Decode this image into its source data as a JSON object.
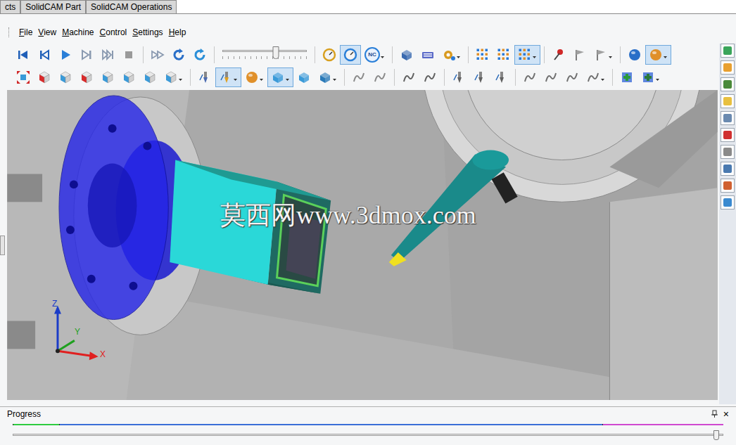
{
  "document_tabs": [
    {
      "label": "cts",
      "selected": false
    },
    {
      "label": "SolidCAM Part",
      "selected": false
    },
    {
      "label": "SolidCAM Operations",
      "selected": false
    }
  ],
  "menu": [
    "File",
    "View",
    "Machine",
    "Control",
    "Settings",
    "Help"
  ],
  "toolbar_top": [
    {
      "kind": "skip-start",
      "selected": false,
      "dropdown": false,
      "color": "#1f5fb8"
    },
    {
      "kind": "step-back",
      "selected": false,
      "dropdown": false,
      "color": "#1f5fb8"
    },
    {
      "kind": "play",
      "selected": false,
      "dropdown": false,
      "color": "#2a7fd8"
    },
    {
      "kind": "step-fwd",
      "selected": false,
      "dropdown": false,
      "color": "#8a9ab0"
    },
    {
      "kind": "skip-end",
      "selected": false,
      "dropdown": false,
      "color": "#8a9ab0"
    },
    {
      "kind": "stop",
      "selected": false,
      "dropdown": false,
      "color": "#9a9a9a"
    },
    {
      "kind": "sep"
    },
    {
      "kind": "fast-forward",
      "selected": false,
      "dropdown": false,
      "color": "#8a9ab0"
    },
    {
      "kind": "rotate",
      "selected": false,
      "dropdown": false,
      "color": "#2a6fc8"
    },
    {
      "kind": "rotate",
      "selected": false,
      "dropdown": false,
      "color": "#2a8fd8"
    },
    {
      "kind": "sep"
    },
    {
      "kind": "slider",
      "level": 0.63
    },
    {
      "kind": "sep"
    },
    {
      "kind": "dial",
      "selected": false,
      "dropdown": false,
      "color": "#d8a020"
    },
    {
      "kind": "dial",
      "selected": true,
      "dropdown": false,
      "color": "#2a7fd8"
    },
    {
      "kind": "badge",
      "label": "NC",
      "selected": false,
      "dropdown": true,
      "color": "#2a7fd8"
    },
    {
      "kind": "sep"
    },
    {
      "kind": "box",
      "selected": false,
      "dropdown": false,
      "color": "#3a6ab0"
    },
    {
      "kind": "keyboard",
      "selected": false,
      "dropdown": false,
      "color": "#5a6ac8"
    },
    {
      "kind": "gear",
      "selected": false,
      "dropdown": true,
      "color": "#d89a20"
    },
    {
      "kind": "sep"
    },
    {
      "kind": "grid",
      "selected": false,
      "dropdown": false,
      "color": "#e0902a"
    },
    {
      "kind": "grid",
      "selected": false,
      "dropdown": false,
      "color": "#e0902a"
    },
    {
      "kind": "grid",
      "selected": true,
      "dropdown": true,
      "color": "#e0902a"
    },
    {
      "kind": "sep"
    },
    {
      "kind": "pin",
      "selected": false,
      "dropdown": false,
      "color": "#d02828"
    },
    {
      "kind": "flag",
      "selected": false,
      "dropdown": false,
      "color": "#a0a0a0"
    },
    {
      "kind": "flag",
      "selected": false,
      "dropdown": true,
      "color": "#a0a0a0"
    },
    {
      "kind": "sep"
    },
    {
      "kind": "sphere",
      "selected": false,
      "dropdown": false,
      "color": "#2a6fc8"
    },
    {
      "kind": "sphere",
      "selected": true,
      "dropdown": true,
      "color": "#e0902a"
    }
  ],
  "toolbar_bottom": [
    {
      "kind": "fit",
      "selected": false,
      "dropdown": false,
      "color": "#d02828"
    },
    {
      "kind": "cube",
      "selected": false,
      "dropdown": false,
      "color": "#d82a2a"
    },
    {
      "kind": "cube",
      "selected": false,
      "dropdown": false,
      "color": "#3a9ad8"
    },
    {
      "kind": "cube",
      "selected": false,
      "dropdown": false,
      "color": "#d82a2a"
    },
    {
      "kind": "cube",
      "selected": false,
      "dropdown": false,
      "color": "#3a9ad8"
    },
    {
      "kind": "cube",
      "selected": false,
      "dropdown": false,
      "color": "#3a9ad8"
    },
    {
      "kind": "cube",
      "selected": false,
      "dropdown": false,
      "color": "#3a9ad8"
    },
    {
      "kind": "cube",
      "selected": false,
      "dropdown": true,
      "color": "#3a9ad8"
    },
    {
      "kind": "sep"
    },
    {
      "kind": "tool",
      "selected": false,
      "dropdown": false,
      "color": "#4a6ab0"
    },
    {
      "kind": "tool",
      "selected": true,
      "dropdown": true,
      "color": "#e0a020"
    },
    {
      "kind": "sphere",
      "selected": false,
      "dropdown": true,
      "color": "#e0902a"
    },
    {
      "kind": "box",
      "selected": true,
      "dropdown": true,
      "color": "#3a9ad8"
    },
    {
      "kind": "box",
      "selected": false,
      "dropdown": false,
      "color": "#3a9ad8"
    },
    {
      "kind": "box",
      "selected": false,
      "dropdown": true,
      "color": "#2a7ab8"
    },
    {
      "kind": "sep"
    },
    {
      "kind": "curve",
      "selected": false,
      "dropdown": false,
      "color": "#8a8a8a"
    },
    {
      "kind": "curve",
      "selected": false,
      "dropdown": false,
      "color": "#8a8a8a"
    },
    {
      "kind": "sep"
    },
    {
      "kind": "curve",
      "selected": false,
      "dropdown": false,
      "color": "#606060"
    },
    {
      "kind": "curve",
      "selected": false,
      "dropdown": false,
      "color": "#606060"
    },
    {
      "kind": "sep"
    },
    {
      "kind": "tool",
      "selected": false,
      "dropdown": false,
      "color": "#606060"
    },
    {
      "kind": "tool",
      "selected": false,
      "dropdown": false,
      "color": "#606060"
    },
    {
      "kind": "tool",
      "selected": false,
      "dropdown": false,
      "color": "#606060"
    },
    {
      "kind": "sep"
    },
    {
      "kind": "curve",
      "selected": false,
      "dropdown": false,
      "color": "#707070"
    },
    {
      "kind": "curve",
      "selected": false,
      "dropdown": false,
      "color": "#707070"
    },
    {
      "kind": "curve",
      "selected": false,
      "dropdown": false,
      "color": "#707070"
    },
    {
      "kind": "curve",
      "selected": false,
      "dropdown": true,
      "color": "#707070"
    },
    {
      "kind": "sep"
    },
    {
      "kind": "add",
      "selected": false,
      "dropdown": false,
      "color": "#2a9a3a"
    },
    {
      "kind": "add",
      "selected": false,
      "dropdown": true,
      "color": "#2a7a3a"
    }
  ],
  "side_panel": [
    {
      "color": "#3aa55a"
    },
    {
      "color": "#e8a030"
    },
    {
      "color": "#4a8a3a"
    },
    {
      "color": "#e8c040"
    },
    {
      "color": "#6a8ab0"
    },
    {
      "color": "#d03030"
    },
    {
      "color": "#8a8a8a"
    },
    {
      "color": "#4a7ab0"
    },
    {
      "color": "#d06030"
    },
    {
      "color": "#3a8ad0"
    }
  ],
  "viewport": {
    "watermark": "莫西网www.3dmox.com",
    "axes": [
      {
        "label": "Z",
        "color": "#1a3cc8"
      },
      {
        "label": "Y",
        "color": "#1fa01f"
      },
      {
        "label": "X",
        "color": "#e02020"
      }
    ]
  },
  "progress_panel": {
    "title": "Progress",
    "close": "×",
    "level": 0.99,
    "segments": [
      {
        "color": "#2ecc40",
        "level": 0.065
      },
      {
        "color": "#3a6fd8",
        "level": 0.765
      },
      {
        "color": "#d04ad0",
        "level": 0.17
      }
    ]
  }
}
